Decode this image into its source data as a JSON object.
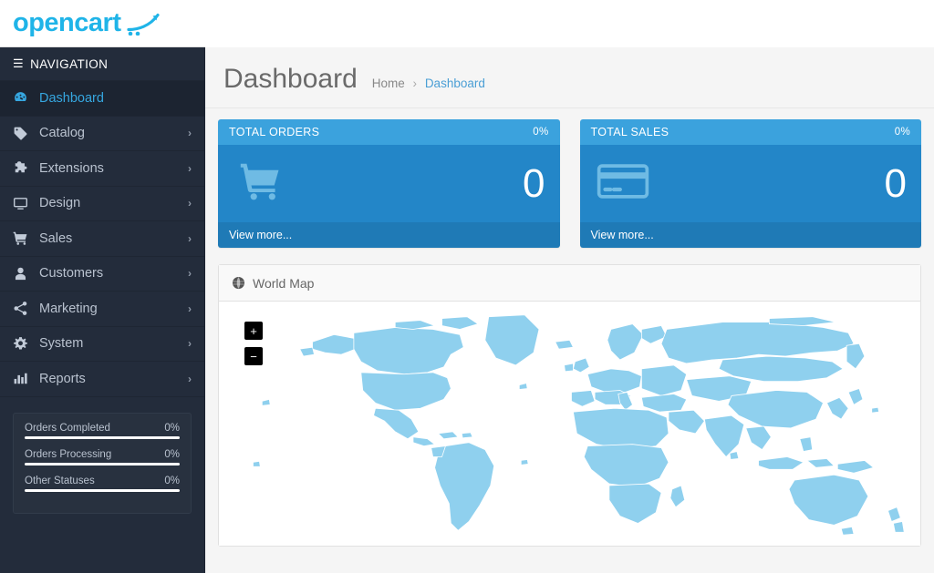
{
  "brand": {
    "name": "opencart",
    "logo_icon": "cart-swoosh-icon",
    "color": "#1fb4e8"
  },
  "sidebar": {
    "header": {
      "label": "NAVIGATION",
      "icon": "hamburger-icon"
    },
    "items": [
      {
        "label": "Dashboard",
        "icon": "dashboard-gauge-icon",
        "active": true,
        "chevron": ""
      },
      {
        "label": "Catalog",
        "icon": "tag-icon",
        "active": false,
        "chevron": "›"
      },
      {
        "label": "Extensions",
        "icon": "puzzle-piece-icon",
        "active": false,
        "chevron": "›"
      },
      {
        "label": "Design",
        "icon": "monitor-icon",
        "active": false,
        "chevron": "›"
      },
      {
        "label": "Sales",
        "icon": "shopping-cart-icon",
        "active": false,
        "chevron": "›"
      },
      {
        "label": "Customers",
        "icon": "user-icon",
        "active": false,
        "chevron": "›"
      },
      {
        "label": "Marketing",
        "icon": "share-nodes-icon",
        "active": false,
        "chevron": "›"
      },
      {
        "label": "System",
        "icon": "gear-icon",
        "active": false,
        "chevron": "›"
      },
      {
        "label": "Reports",
        "icon": "bar-chart-icon",
        "active": false,
        "chevron": "›"
      }
    ],
    "stats": [
      {
        "label": "Orders Completed",
        "value": "0%",
        "percent": 0
      },
      {
        "label": "Orders Processing",
        "value": "0%",
        "percent": 0
      },
      {
        "label": "Other Statuses",
        "value": "0%",
        "percent": 0
      }
    ]
  },
  "page": {
    "title": "Dashboard",
    "breadcrumb": {
      "home": "Home",
      "separator": "›",
      "current": "Dashboard"
    }
  },
  "tiles": [
    {
      "title": "TOTAL ORDERS",
      "percent": "0%",
      "value": "0",
      "footer": "View more...",
      "icon": "shopping-cart-icon",
      "head_color": "#3ba2dd",
      "body_color": "#2386c8",
      "foot_color": "#1f7ab6"
    },
    {
      "title": "TOTAL SALES",
      "percent": "0%",
      "value": "0",
      "footer": "View more...",
      "icon": "credit-card-icon",
      "head_color": "#3ba2dd",
      "body_color": "#2386c8",
      "foot_color": "#1f7ab6"
    }
  ],
  "map_panel": {
    "title": "World Map",
    "icon": "globe-icon",
    "zoom_in": "+",
    "zoom_out": "−",
    "land_color": "#8fd0ee",
    "border_color": "#ffffff"
  }
}
